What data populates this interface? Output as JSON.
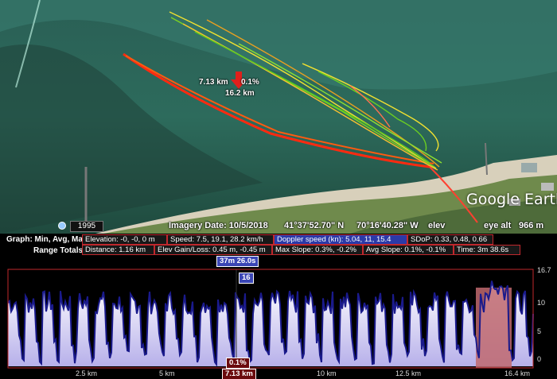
{
  "map": {
    "imagery_date": "Imagery Date: 10/5/2018",
    "lat": "41°37'52.70\" N",
    "lon": "70°16'40.28\" W",
    "elev_label": "elev",
    "eye_alt_label": "eye alt",
    "eye_alt_value": "966 m",
    "year": "1995",
    "logo": "Google Earth",
    "marker_distance": "7.13 km",
    "marker_slope": "0.1%",
    "marker_total": "16.2 km"
  },
  "stats": {
    "graph_label": "Graph: Min, Avg, Max",
    "range_label": "Range Totals:",
    "elevation": "Elevation: -0, -0, 0 m",
    "speed": "Speed: 7.5, 19.1, 28.2 km/h",
    "doppler": "Doppler speed (kn): 5.04, 11, 15.4",
    "sdop": "SDoP: 0.33, 0.48, 0.66",
    "distance": "Distance: 1.16 km",
    "elev_gain": "Elev Gain/Loss: 0.45 m, -0.45 m",
    "max_slope": "Max Slope: 0.3%, -0.2%",
    "avg_slope": "Avg Slope: 0.1%, -0.1%",
    "time": "Time: 3m 38.6s"
  },
  "graph": {
    "cursor_time": "37m 26.0s",
    "cursor_value": "16",
    "cursor_slope": "0.1%",
    "x_ticks": [
      "2.5 km",
      "5 km",
      "7.13 km",
      "10 km",
      "12.5 km",
      "16.4 km"
    ],
    "y_ticks": [
      "16.7",
      "10",
      "5",
      "0"
    ],
    "colors": {
      "line": "#1a1a8c",
      "fill": "#c9c3f0",
      "selection": "#c0686e",
      "border": "#c0282d"
    }
  }
}
